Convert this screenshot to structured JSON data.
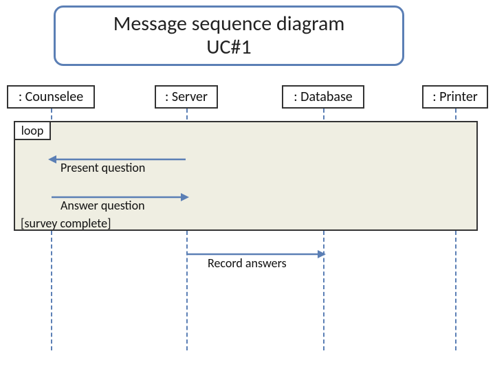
{
  "title": "Message sequence diagram\nUC#1",
  "participants": {
    "p1": ": Counselee",
    "p2": ": Server",
    "p3": ": Database",
    "p4": ": Printer"
  },
  "fragment": {
    "operator": "loop",
    "guard": "[survey complete]"
  },
  "messages": {
    "m1": "Present question",
    "m2": "Answer question",
    "m3": "Record answers"
  },
  "chart_data": {
    "type": "sequence-diagram",
    "title": "Message sequence diagram UC#1",
    "participants": [
      {
        "id": "counselee",
        "label": ": Counselee"
      },
      {
        "id": "server",
        "label": ": Server"
      },
      {
        "id": "database",
        "label": ": Database"
      },
      {
        "id": "printer",
        "label": ": Printer"
      }
    ],
    "fragments": [
      {
        "type": "loop",
        "guard": "[survey complete]",
        "messages": [
          {
            "from": "server",
            "to": "counselee",
            "label": "Present question"
          },
          {
            "from": "counselee",
            "to": "server",
            "label": "Answer question"
          }
        ]
      }
    ],
    "messages_after": [
      {
        "from": "server",
        "to": "database",
        "label": "Record answers"
      }
    ]
  }
}
